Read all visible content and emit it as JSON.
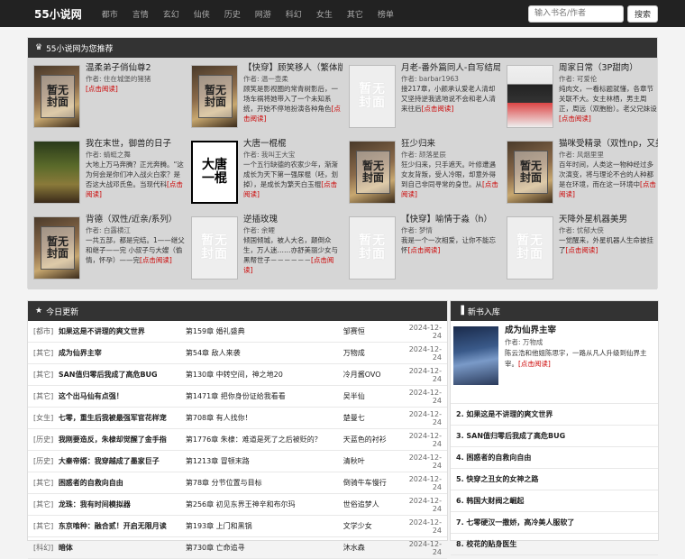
{
  "nav": {
    "brand": "55小说网",
    "items": [
      "都市",
      "言情",
      "玄幻",
      "仙侠",
      "历史",
      "网游",
      "科幻",
      "女生",
      "其它",
      "榜单"
    ],
    "search_placeholder": "输入书名/作者",
    "search_button": "搜索"
  },
  "recommend": {
    "heading": "55小说网为您推荐",
    "more_label": "[点击阅读]",
    "books": [
      {
        "title": "温柔弟子俏仙尊2",
        "author": "作者: 住在城堡的猪猪",
        "desc": "",
        "cover": "none"
      },
      {
        "title": "【快穿】顾笑移人（繁体版）",
        "author": "作者: 温一壶柔",
        "desc": "顾笑是影视圈的常青树影后，一场车祸将她带入了一个未知系统，开始不停地扮演各种角色",
        "cover": "none"
      },
      {
        "title": "月老-番外篇同人-自写结局",
        "author": "作者: barbar1963",
        "desc": "接217章，小颜承认爱老人清却又坚持逆我逃地说不会和老人清来往后",
        "cover": "none-plain"
      },
      {
        "title": "周家日常（3P甜肉）",
        "author": "作者: 可爱伦",
        "desc": "纯肉文，一看标题就懂，各章节关联不大。女主林栖，男主周正，周远（双胞胎）。老父兄妹设",
        "cover": "anime"
      },
      {
        "title": "我在末世，御兽的日子",
        "author": "作者: 蜻蜓之舞",
        "desc": "大地上万马奔腾？正光奔腾。“这为何会是你们冲入战火白家？是否这大战邓氏鱼。当现代科",
        "cover": "forest"
      },
      {
        "title": "大唐一棍棍",
        "author": "作者: 我叫王大宝",
        "desc": "一个五行缺德的农家少年，渐渐成长为天下第一强尿棍（呸，划掉），是成长为繁天白玉棍",
        "cover": "bw"
      },
      {
        "title": "狂少归来",
        "author": "作者: 颉落星辰",
        "desc": "狂少归来，只手遮天。叶修遭遇女友背叛，受人冷眼，却意外得到自己非同寻常的身世。从",
        "cover": "none"
      },
      {
        "title": "猫咪受精录（双性np，又美又不喷猫咪受）",
        "author": "作者: 风烟里里",
        "desc": "百年时间，人类这一物种经过多次演变，将与理论不合的人种都是在环境，而在这一环境中",
        "cover": "none"
      },
      {
        "title": "背德（双性/近亲/系列）",
        "author": "作者: 白露横江",
        "desc": "一共五部，都是完结。1——继父和继子——完 小叔子与大嫂（偷情，怀孕）——完",
        "cover": "none"
      },
      {
        "title": "逆插玫瑰",
        "author": "作者: 余鲤",
        "desc": "倾国倾城，被人大名，颠倒众生，万人迷……亦舒美丽少女与黑帮世子－－－－－－",
        "cover": "none-plain"
      },
      {
        "title": "【快穿】喻情于淼（h）",
        "author": "作者: 梦情",
        "desc": "我是一个一次相爱，让你不能忘怀",
        "cover": "none-plain"
      },
      {
        "title": "天降外星机器美男",
        "author": "作者: 忧郁大侠",
        "desc": "一觉醒来，外星机器人生命披挂了",
        "cover": "none-plain"
      }
    ]
  },
  "today": {
    "heading": "今日更新",
    "rows": [
      {
        "cat": "[都市]",
        "name": "如果这是不讲理的爽文世界",
        "chap": "第159章 婚礼盛典",
        "auth": "邹赛恒",
        "date": "2024-12-24"
      },
      {
        "cat": "[其它]",
        "name": "成为仙界主宰",
        "chap": "第54章 敌人来袭",
        "auth": "万物成",
        "date": "2024-12-24"
      },
      {
        "cat": "[其它]",
        "name": "SAN值归零后我成了高危BUG",
        "chap": "第130章 中转空间，神之地20",
        "auth": "冷月酱OVO",
        "date": "2024-12-24"
      },
      {
        "cat": "[其它]",
        "name": "这个出马仙有点强！",
        "chap": "第1471章 把你身份证给我看看",
        "auth": "吴半仙",
        "date": "2024-12-24"
      },
      {
        "cat": "[女生]",
        "name": "七零，重生后我被最强军官花样宠",
        "chap": "第708章 有人找你！",
        "auth": "楚曼七",
        "date": "2024-12-24"
      },
      {
        "cat": "[历史]",
        "name": "我刚要造反，朱棣却觉醒了金手指",
        "chap": "第1776章 朱棣：难道是死了之后被贬的？",
        "auth": "天蓝色的衬衫",
        "date": "2024-12-24"
      },
      {
        "cat": "[历史]",
        "name": "大秦帝婿：我穿越成了墨家巨子",
        "chap": "第1213章 冒顿末路",
        "auth": "清秋叶",
        "date": "2024-12-24"
      },
      {
        "cat": "[其它]",
        "name": "困惑者的自救向自由",
        "chap": "第78章 分节位置与目标",
        "auth": "倒骑牛车慢行",
        "date": "2024-12-24"
      },
      {
        "cat": "[其它]",
        "name": "龙珠：我有时间模拟器",
        "chap": "第256章 初见东界王神辛和布尔玛",
        "auth": "世俗追梦人",
        "date": "2024-12-24"
      },
      {
        "cat": "[其它]",
        "name": "东京喰种：融合贰！开启无限月读",
        "chap": "第193章 上门和黑锅",
        "auth": "文学少女",
        "date": "2024-12-24"
      },
      {
        "cat": "[科幻]",
        "name": "暗体",
        "chap": "第730章 亡命追寻",
        "auth": "沐水森",
        "date": "2024-12-24"
      }
    ]
  },
  "newbooks": {
    "heading": "新书入库",
    "top": {
      "title": "成为仙界主宰",
      "author": "作者: 万物成",
      "desc": "陈云浩和他姐陈思宇，一路从凡人升级到仙界主宰。",
      "more": "[点击阅读]"
    },
    "items": [
      "2. 如果这是不讲理的爽文世界",
      "3. SAN值归零后我成了高危BUG",
      "4. 困惑者的自救向自由",
      "5. 快穿之丑女的女神之路",
      "6. 韩国大财阀之崛起",
      "7. 七零硬汉一撒娇，高冷美人服软了",
      "8. 校花的贴身医生"
    ]
  }
}
